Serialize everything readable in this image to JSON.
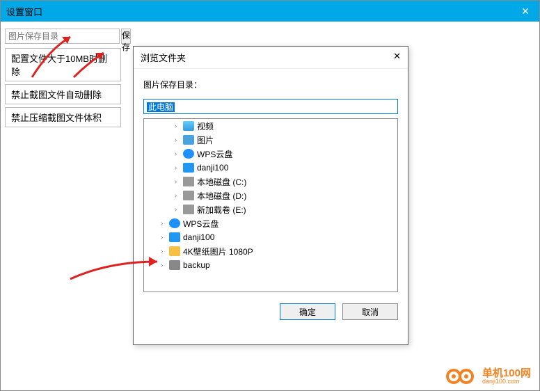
{
  "titlebar": {
    "title": "设置窗口"
  },
  "sidebar": {
    "path_placeholder": "图片保存目录",
    "save_btn": "保存",
    "items": [
      "配置文件大于10MB时删除",
      "禁止截图文件自动删除",
      "禁止压缩截图文件体积"
    ]
  },
  "modal": {
    "title": "浏览文件夹",
    "label": "图片保存目录：",
    "selected_path": "此电脑",
    "tree": [
      {
        "lvl": 2,
        "icon": "video",
        "label": "视频"
      },
      {
        "lvl": 2,
        "icon": "pic",
        "label": "图片"
      },
      {
        "lvl": 2,
        "icon": "wps",
        "label": "WPS云盘"
      },
      {
        "lvl": 2,
        "icon": "danji",
        "label": "danji100"
      },
      {
        "lvl": 2,
        "icon": "drive",
        "label": "本地磁盘 (C:)"
      },
      {
        "lvl": 2,
        "icon": "drive",
        "label": "本地磁盘 (D:)"
      },
      {
        "lvl": 2,
        "icon": "drive",
        "label": "新加载卷 (E:)"
      },
      {
        "lvl": 1,
        "icon": "wps",
        "label": "WPS云盘"
      },
      {
        "lvl": 1,
        "icon": "danji",
        "label": "danji100"
      },
      {
        "lvl": 1,
        "icon": "folder",
        "label": "4K壁纸图片 1080P"
      },
      {
        "lvl": 1,
        "icon": "backup",
        "label": "backup"
      }
    ],
    "ok_btn": "确定",
    "cancel_btn": "取消"
  },
  "logo": {
    "name": "单机100网",
    "url": "danji100.com"
  }
}
